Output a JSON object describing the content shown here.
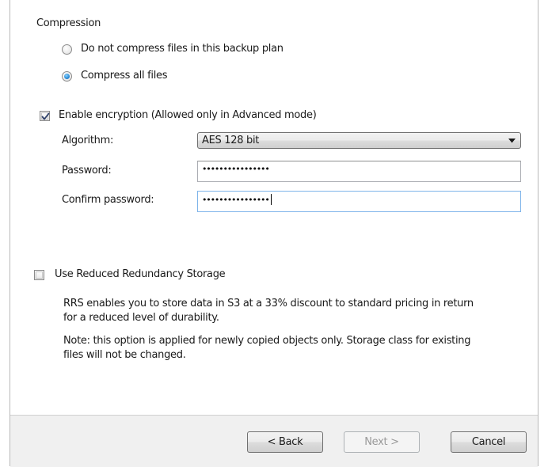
{
  "compression": {
    "group_label": "Compression",
    "option_none_label": "Do not compress files in this backup plan",
    "option_all_label": "Compress all files",
    "selected": "all"
  },
  "encryption": {
    "enable_label": "Enable encryption (Allowed only in Advanced mode)",
    "enabled": true,
    "algorithm_label": "Algorithm:",
    "algorithm_value": "AES 128 bit",
    "password_label": "Password:",
    "password_mask": "••••••••••••••••",
    "confirm_label": "Confirm password:",
    "confirm_mask": "••••••••••••••••"
  },
  "rrs": {
    "checkbox_label": "Use Reduced Redundancy Storage",
    "checked": false,
    "description_line1": "RRS enables you to store data in S3 at a 33% discount to standard pricing in return",
    "description_line2": "for a reduced level of durability.",
    "note_line1": "Note: this option is applied for newly copied objects only. Storage class for existing",
    "note_line2": "files will not be changed."
  },
  "footer": {
    "back_label": "< Back",
    "next_label": "Next >",
    "next_enabled": false,
    "cancel_label": "Cancel"
  },
  "colors": {
    "radio_selected": "#2f8fd8",
    "checkmark": "#2c3e68",
    "footer_bg": "#f0f0f0"
  }
}
